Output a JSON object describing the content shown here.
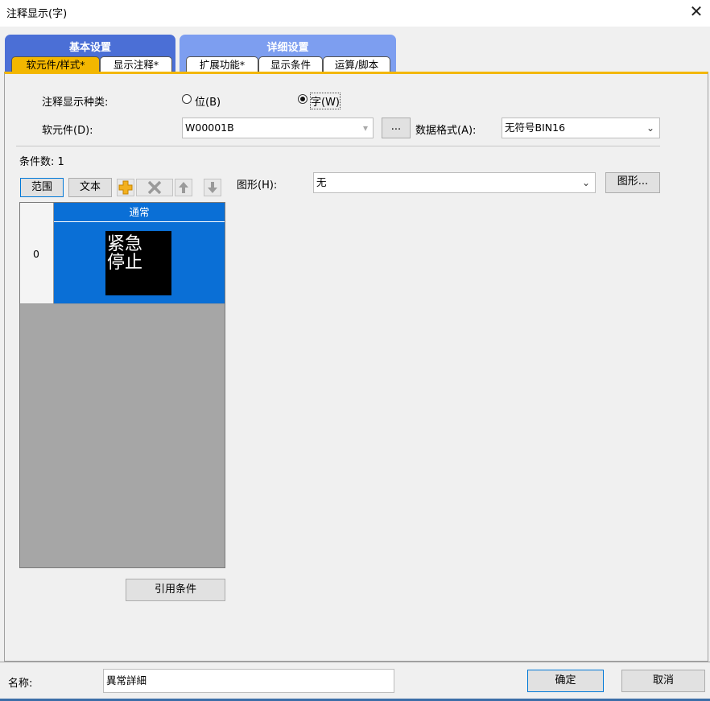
{
  "window": {
    "title": "注释显示(字)",
    "close_glyph": "✕"
  },
  "groups": {
    "basic": {
      "label": "基本设置",
      "tabs": [
        "软元件/样式*",
        "显示注释*"
      ]
    },
    "detail": {
      "label": "详细设置",
      "tabs": [
        "扩展功能*",
        "显示条件",
        "运算/脚本"
      ]
    }
  },
  "form": {
    "comment_type_label": "注释显示种类:",
    "radio_bit": "位(B)",
    "radio_word": "字(W)",
    "device_label": "软元件(D):",
    "device_value": "W00001B",
    "browse_label": "...",
    "format_label": "数据格式(A):",
    "format_value": "无符号BIN16",
    "condition_count": "条件数: 1"
  },
  "toolbar": {
    "range": "范围",
    "text": "文本"
  },
  "grid": {
    "row_index": "0",
    "column_header": "通常",
    "preview_text_line1": "紧急",
    "preview_text_line2": "停止"
  },
  "shape": {
    "label": "图形(H):",
    "value": "无",
    "button": "图形..."
  },
  "quote_button": "引用条件",
  "footer": {
    "name_label": "名称:",
    "name_value": "異常詳細",
    "ok": "确定",
    "cancel": "取消"
  },
  "colors": {
    "accent_tab": "#f3b700",
    "group_basic": "#4b6fd6",
    "group_detail": "#7d9ef0",
    "selection": "#0a6fd6"
  }
}
